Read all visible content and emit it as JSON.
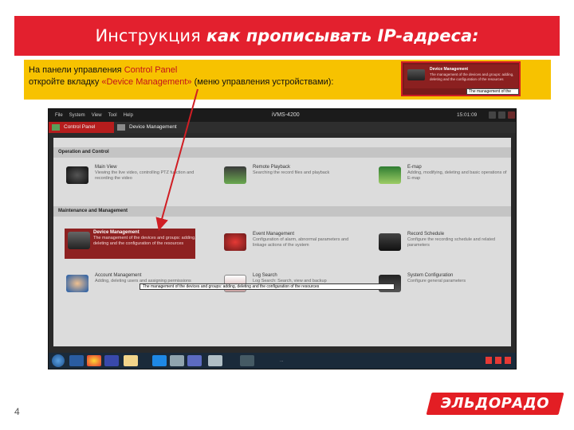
{
  "slide": {
    "title_plain": "Инструкция",
    "title_emph": "как прописывать IP-адреса:",
    "page_number": "4"
  },
  "instruction": {
    "line1_prefix": "На панели управления ",
    "line1_hl": "Control Panel",
    "line2_prefix": "откройте вкладку ",
    "line2_hl": "«Device Management»",
    "line2_suffix": " (меню управления устройствами):"
  },
  "inset": {
    "title": "Device Management",
    "description": "The management of the devices and groups: adding, deleting and the configuration of the resources",
    "tooltip": "The management of the"
  },
  "app": {
    "menu": [
      "File",
      "System",
      "View",
      "Tool",
      "Help"
    ],
    "window_title": "iVMS-4200",
    "clock": "15:01:09",
    "tabs": [
      {
        "label": "Control Panel"
      },
      {
        "label": "Device Management"
      }
    ],
    "sections": {
      "operation": "Operation and Control",
      "maintenance": "Maintenance and Management"
    },
    "items": [
      {
        "title": "Main View",
        "desc": "Viewing the live video, controlling PTZ function and recording the video"
      },
      {
        "title": "Remote Playback",
        "desc": "Searching the record files and playback"
      },
      {
        "title": "E-map",
        "desc": "Adding, modifying, deleting and basic operations of E-map"
      },
      {
        "title": "Device Management",
        "desc": "The management of the devices and groups: adding, deleting and the configuration of the resources"
      },
      {
        "title": "Event Management",
        "desc": "Configuration of alarm, abnormal parameters and linkage actions of the system"
      },
      {
        "title": "Record Schedule",
        "desc": "Configure the recording schedule and related parameters"
      },
      {
        "title": "Account Management",
        "desc": "Adding, deleting users and assigning permissions"
      },
      {
        "title": "Log Search",
        "desc": "Log Search: Search, view and backup"
      },
      {
        "title": "System Configuration",
        "desc": "Configure general parameters"
      }
    ],
    "tooltip": "The management of the devices and groups: adding, deleting and the configuration of the resources",
    "taskbar_text": "..."
  },
  "brand": {
    "logo_text": "ЭЛЬДОРАДО",
    "red": "#e3202e",
    "yellow": "#f7c200"
  }
}
